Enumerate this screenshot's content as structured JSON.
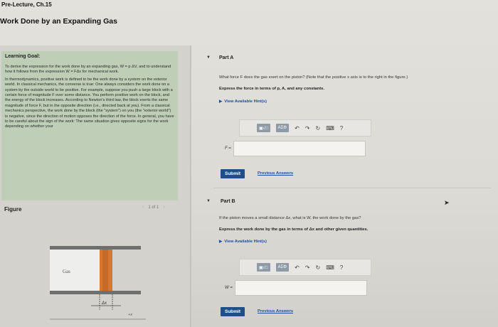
{
  "breadcrumb": "Pre-Lecture, Ch.15",
  "page_title": "Work Done by an Expanding Gas",
  "learning_goal": {
    "heading": "Learning Goal:",
    "p1": "To derive the expression for the work done by an expanding gas, W = p ΔV, and to understand how it follows from the expression W = FΔx for mechanical work.",
    "p2": "In thermodynamics, positive work is defined to be the work done by a system on the exterior world. In classical mechanics, the converse is true: One always considers the work done on a system by the outside world to be positive. For example, suppose you push a large block with a certain force of magnitude F over some distance. You perform positive work on the block, and the energy of the block increases. According to Newton's third law, the block exerts the same magnitude of force F, but in the opposite direction (i.e., directed back at you). From a classical mechanics perspective, the work done by the block (the \"system\") on you (the \"exterior world\") is negative, since the direction of motion opposes the direction of the force. In general, you have to be careful about the sign of the work: The same situation gives opposite signs for the work depending on whether your"
  },
  "figure": {
    "label": "Figure",
    "pager": "1 of 1",
    "gas_label": "Gas",
    "dx_label": "Δx",
    "axis_label": "+x"
  },
  "part_a": {
    "title": "Part A",
    "question": "What force F does the gas exert on the piston? (Note that the positive x axis is to the right in the figure.)",
    "instruction": "Express the force in terms of p, A, and any constants.",
    "hint": "View Available Hint(s)",
    "answer_label": "F =",
    "submit": "Submit",
    "previous": "Previous Answers"
  },
  "part_b": {
    "title": "Part B",
    "question": "If the piston moves a small distance Δx, what is W, the work done by the gas?",
    "instruction": "Express the work done by the gas in terms of Δx and other given quantities.",
    "hint": "View Available Hint(s)",
    "answer_label": "W =",
    "submit": "Submit",
    "previous": "Previous Answers"
  },
  "toolbar": {
    "templates": "▣√□",
    "symbols": "ΑΣΦ",
    "undo": "↶",
    "redo": "↷",
    "reset": "↻",
    "keyboard": "⌨",
    "help": "?"
  },
  "colors": {
    "goal_bg": "#bfcfb7",
    "submit_bg": "#1f4f86",
    "link": "#1f4e99",
    "piston": "#d9772f"
  }
}
